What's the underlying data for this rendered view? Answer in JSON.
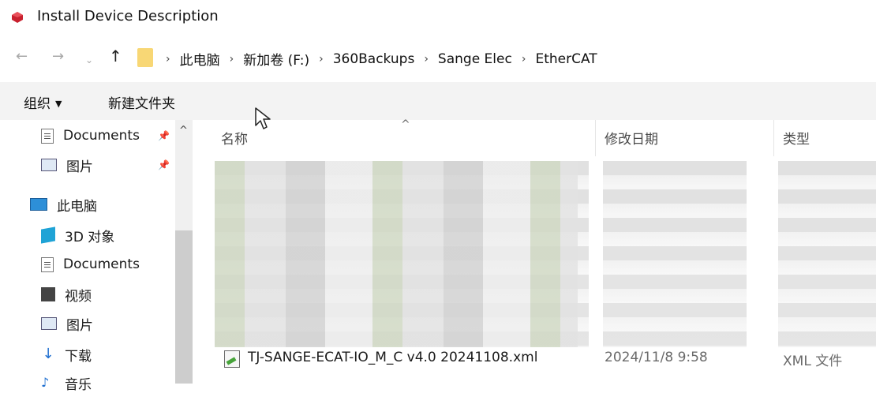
{
  "window": {
    "title": "Install Device Description",
    "icon": "app-logo-icon"
  },
  "nav": {
    "back_icon": "arrow-left-icon",
    "forward_icon": "arrow-right-icon",
    "recent_icon": "chevron-down-icon",
    "up_icon": "arrow-up-icon",
    "breadcrumbs": [
      "此电脑",
      "新加卷 (F:)",
      "360Backups",
      "Sange Elec",
      "EtherCAT"
    ]
  },
  "toolbar": {
    "organize_label": "组织",
    "new_folder_label": "新建文件夹"
  },
  "sidebar": {
    "items": [
      {
        "label": "Documents",
        "icon": "document-icon",
        "pinned": true
      },
      {
        "label": "图片",
        "icon": "pictures-icon",
        "pinned": true
      },
      {
        "label": "此电脑",
        "icon": "computer-icon"
      },
      {
        "label": "3D 对象",
        "icon": "3d-objects-icon"
      },
      {
        "label": "Documents",
        "icon": "document-icon"
      },
      {
        "label": "视频",
        "icon": "video-icon"
      },
      {
        "label": "图片",
        "icon": "pictures-icon"
      },
      {
        "label": "下载",
        "icon": "download-icon"
      },
      {
        "label": "音乐",
        "icon": "music-icon"
      }
    ]
  },
  "columns": {
    "name": "名称",
    "date": "修改日期",
    "type": "类型"
  },
  "files": [
    {
      "name": "TJ-SANGE-ECAT-IO_M_C v4.0 20241108.xml",
      "date": "2024/11/8 9:58",
      "type": "XML 文件"
    }
  ]
}
